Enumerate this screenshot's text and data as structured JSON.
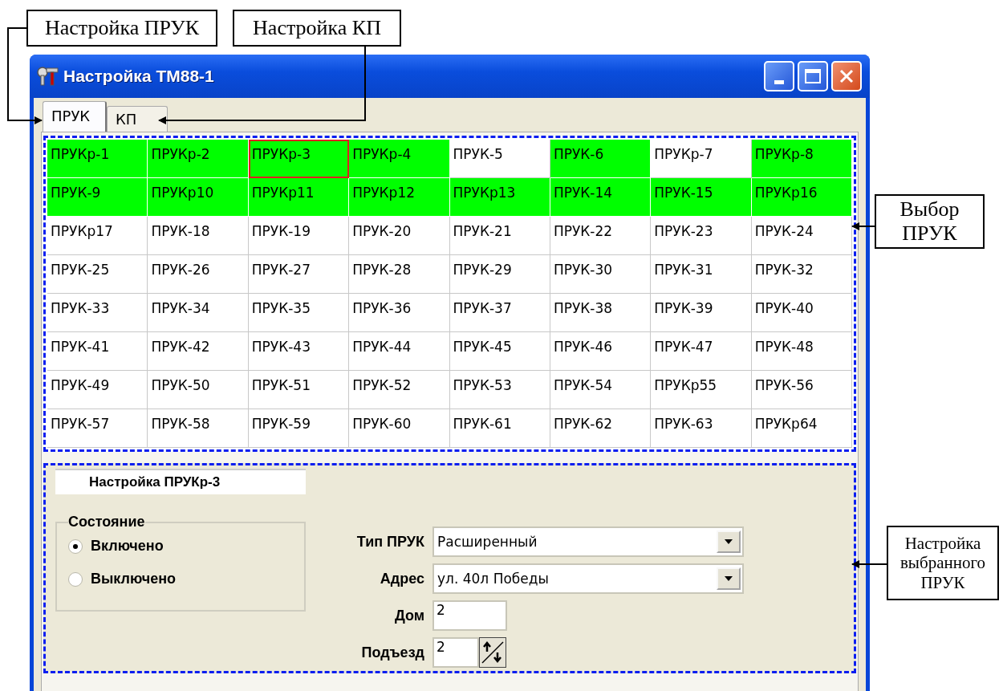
{
  "annotations": [
    {
      "text": "Настройка ПРУК"
    },
    {
      "text": "Настройка КП"
    },
    {
      "text": "Выбор ПРУК"
    },
    {
      "text": "Настройка выбранного ПРУК"
    }
  ],
  "window": {
    "title": "Настройка ТМ88-1"
  },
  "tabs": [
    {
      "label": "ПРУК",
      "selected": true
    },
    {
      "label": "КП",
      "selected": false
    }
  ],
  "grid": {
    "cells": [
      {
        "label": "ПРУКр-1",
        "active": true,
        "selected": false
      },
      {
        "label": "ПРУКр-2",
        "active": true,
        "selected": false
      },
      {
        "label": "ПРУКр-3",
        "active": true,
        "selected": true
      },
      {
        "label": "ПРУКр-4",
        "active": true,
        "selected": false
      },
      {
        "label": "ПРУК-5",
        "active": false,
        "selected": false
      },
      {
        "label": "ПРУК-6",
        "active": true,
        "selected": false
      },
      {
        "label": "ПРУКр-7",
        "active": false,
        "selected": false
      },
      {
        "label": "ПРУКр-8",
        "active": true,
        "selected": false
      },
      {
        "label": "ПРУК-9",
        "active": true,
        "selected": false
      },
      {
        "label": "ПРУКр10",
        "active": true,
        "selected": false
      },
      {
        "label": "ПРУКр11",
        "active": true,
        "selected": false
      },
      {
        "label": "ПРУКр12",
        "active": true,
        "selected": false
      },
      {
        "label": "ПРУКр13",
        "active": true,
        "selected": false
      },
      {
        "label": "ПРУК-14",
        "active": true,
        "selected": false
      },
      {
        "label": "ПРУК-15",
        "active": true,
        "selected": false
      },
      {
        "label": "ПРУКр16",
        "active": true,
        "selected": false
      },
      {
        "label": "ПРУКр17",
        "active": false,
        "selected": false
      },
      {
        "label": "ПРУК-18",
        "active": false,
        "selected": false
      },
      {
        "label": "ПРУК-19",
        "active": false,
        "selected": false
      },
      {
        "label": "ПРУК-20",
        "active": false,
        "selected": false
      },
      {
        "label": "ПРУК-21",
        "active": false,
        "selected": false
      },
      {
        "label": "ПРУК-22",
        "active": false,
        "selected": false
      },
      {
        "label": "ПРУК-23",
        "active": false,
        "selected": false
      },
      {
        "label": "ПРУК-24",
        "active": false,
        "selected": false
      },
      {
        "label": "ПРУК-25",
        "active": false,
        "selected": false
      },
      {
        "label": "ПРУК-26",
        "active": false,
        "selected": false
      },
      {
        "label": "ПРУК-27",
        "active": false,
        "selected": false
      },
      {
        "label": "ПРУК-28",
        "active": false,
        "selected": false
      },
      {
        "label": "ПРУК-29",
        "active": false,
        "selected": false
      },
      {
        "label": "ПРУК-30",
        "active": false,
        "selected": false
      },
      {
        "label": "ПРУК-31",
        "active": false,
        "selected": false
      },
      {
        "label": "ПРУК-32",
        "active": false,
        "selected": false
      },
      {
        "label": "ПРУК-33",
        "active": false,
        "selected": false
      },
      {
        "label": "ПРУК-34",
        "active": false,
        "selected": false
      },
      {
        "label": "ПРУК-35",
        "active": false,
        "selected": false
      },
      {
        "label": "ПРУК-36",
        "active": false,
        "selected": false
      },
      {
        "label": "ПРУК-37",
        "active": false,
        "selected": false
      },
      {
        "label": "ПРУК-38",
        "active": false,
        "selected": false
      },
      {
        "label": "ПРУК-39",
        "active": false,
        "selected": false
      },
      {
        "label": "ПРУК-40",
        "active": false,
        "selected": false
      },
      {
        "label": "ПРУК-41",
        "active": false,
        "selected": false
      },
      {
        "label": "ПРУК-42",
        "active": false,
        "selected": false
      },
      {
        "label": "ПРУК-43",
        "active": false,
        "selected": false
      },
      {
        "label": "ПРУК-44",
        "active": false,
        "selected": false
      },
      {
        "label": "ПРУК-45",
        "active": false,
        "selected": false
      },
      {
        "label": "ПРУК-46",
        "active": false,
        "selected": false
      },
      {
        "label": "ПРУК-47",
        "active": false,
        "selected": false
      },
      {
        "label": "ПРУК-48",
        "active": false,
        "selected": false
      },
      {
        "label": "ПРУК-49",
        "active": false,
        "selected": false
      },
      {
        "label": "ПРУК-50",
        "active": false,
        "selected": false
      },
      {
        "label": "ПРУК-51",
        "active": false,
        "selected": false
      },
      {
        "label": "ПРУК-52",
        "active": false,
        "selected": false
      },
      {
        "label": "ПРУК-53",
        "active": false,
        "selected": false
      },
      {
        "label": "ПРУК-54",
        "active": false,
        "selected": false
      },
      {
        "label": "ПРУКр55",
        "active": false,
        "selected": false
      },
      {
        "label": "ПРУК-56",
        "active": false,
        "selected": false
      },
      {
        "label": "ПРУК-57",
        "active": false,
        "selected": false
      },
      {
        "label": "ПРУК-58",
        "active": false,
        "selected": false
      },
      {
        "label": "ПРУК-59",
        "active": false,
        "selected": false
      },
      {
        "label": "ПРУК-60",
        "active": false,
        "selected": false
      },
      {
        "label": "ПРУК-61",
        "active": false,
        "selected": false
      },
      {
        "label": "ПРУК-62",
        "active": false,
        "selected": false
      },
      {
        "label": "ПРУК-63",
        "active": false,
        "selected": false
      },
      {
        "label": "ПРУКр64",
        "active": false,
        "selected": false
      }
    ]
  },
  "settings": {
    "header": "Настройка ПРУКр-3",
    "state_group": {
      "title": "Состояние",
      "options": [
        {
          "label": "Включено",
          "selected": true
        },
        {
          "label": "Выключено",
          "selected": false
        }
      ]
    },
    "fields": [
      {
        "kind": "combo",
        "label": "Тип ПРУК",
        "value": "Расширенный"
      },
      {
        "kind": "combo",
        "label": "Адрес",
        "value": "ул. 40л Победы"
      },
      {
        "kind": "text",
        "label": "Дом",
        "value": "2"
      },
      {
        "kind": "spin",
        "label": "Подъезд",
        "value": "2"
      }
    ]
  }
}
